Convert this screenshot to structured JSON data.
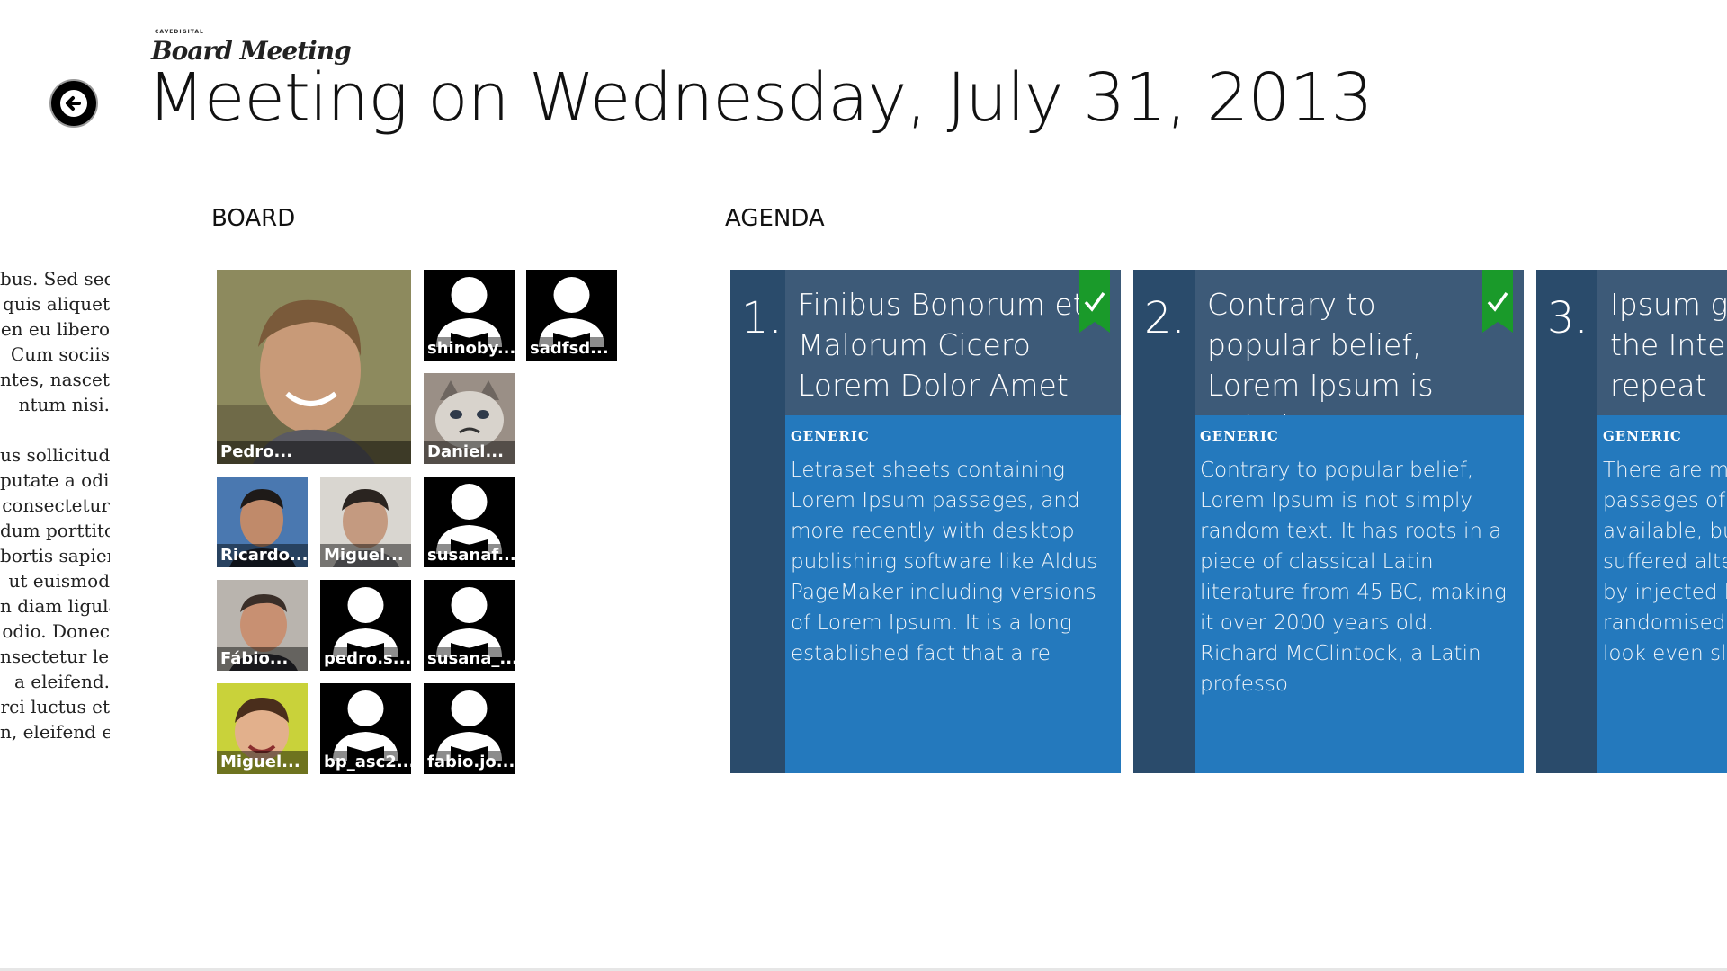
{
  "app": {
    "logo_small": "CAVEDIGITAL",
    "logo_main": "Board Meeting"
  },
  "page": {
    "title": "Meeting on Wednesday, July 31, 2013"
  },
  "left_text": {
    "block1": [
      "bus. Sed sed",
      "quis aliquet",
      "en eu libero",
      "Cum sociis",
      "ntes, nascetur",
      "ntum nisi."
    ],
    "block2": [
      "us sollicitudin",
      "putate a odio",
      "consectetur",
      "dum porttitor",
      "bortis sapien",
      "ut euismod",
      "n diam ligula,",
      "odio. Donec",
      "nsectetur leo",
      "a eleifend.",
      "rci luctus et",
      "n, eleifend et"
    ]
  },
  "sections": {
    "board": "BOARD",
    "agenda": "AGENDA"
  },
  "board": {
    "members": [
      {
        "name": "Pedro...",
        "avatar": "photo-pedro"
      },
      {
        "name": "shinoby...",
        "avatar": "default-user-icon"
      },
      {
        "name": "sadfsd...",
        "avatar": "default-user-icon"
      },
      {
        "name": "Daniel...",
        "avatar": "photo-cat"
      },
      {
        "name": "Ricardo...",
        "avatar": "photo-ricardo"
      },
      {
        "name": "Miguel...",
        "avatar": "photo-miguel"
      },
      {
        "name": "susanaf...",
        "avatar": "default-user-icon"
      },
      {
        "name": "Fábio...",
        "avatar": "photo-fabio"
      },
      {
        "name": "pedro.s...",
        "avatar": "default-user-icon"
      },
      {
        "name": "susana_...",
        "avatar": "default-user-icon"
      },
      {
        "name": "Miguel...",
        "avatar": "photo-child"
      },
      {
        "name": "bp_asc2...",
        "avatar": "default-user-icon"
      },
      {
        "name": "fabio.jo...",
        "avatar": "default-user-icon"
      }
    ]
  },
  "agenda": {
    "items": [
      {
        "number": "1.",
        "title": "Finibus Bonorum et Malorum Cicero Lorem Dolor Amet",
        "category": "GENERIC",
        "description": "Letraset sheets containing Lorem Ipsum passages, and more recently with desktop publishing software like Aldus PageMaker including versions of Lorem Ipsum.     It is a long established fact that a re",
        "checked": true
      },
      {
        "number": "2.",
        "title": "Contrary to popular belief, Lorem Ipsum is not sim",
        "category": "GENERIC",
        "description": "Contrary to popular belief, Lorem Ipsum is not simply random text. It has roots in a piece of classical Latin literature from 45 BC, making it over 2000 years old. Richard McClintock, a Latin professo",
        "checked": true
      },
      {
        "number": "3.",
        "title_lines": [
          "Ipsum ge",
          "the Interr",
          "repeat"
        ],
        "category": "GENERIC",
        "description_lines": [
          "There are ma",
          "passages of L",
          "available, but",
          "suffered alte",
          "by injected h",
          "randomised w",
          "look even slig"
        ],
        "checked": false
      }
    ]
  },
  "colors": {
    "card_number_bg": "#2a4b6b",
    "card_header_bg": "#3d5a78",
    "card_body_bg": "#2479bd",
    "check_green": "#1a9a2a"
  }
}
